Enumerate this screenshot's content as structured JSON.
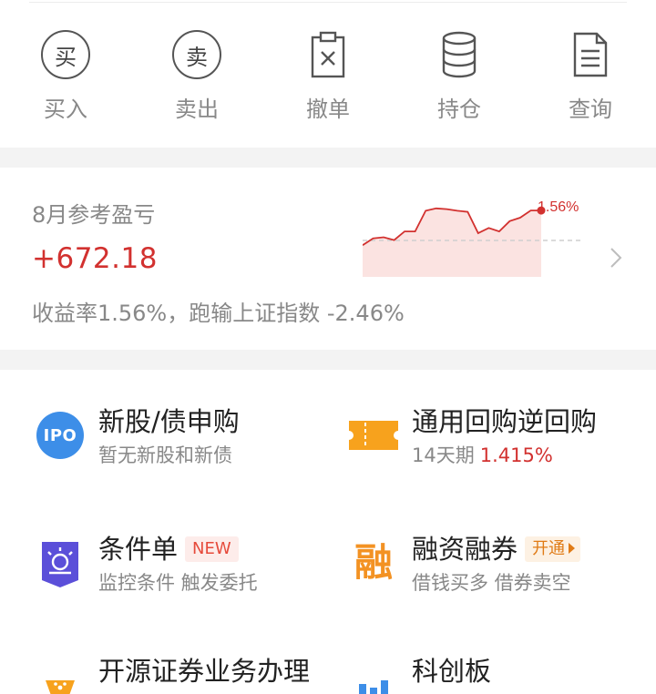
{
  "actions": [
    {
      "id": "buy",
      "icon_char": "买",
      "label": "买入",
      "icon": "buy-circle-icon"
    },
    {
      "id": "sell",
      "icon_char": "卖",
      "label": "卖出",
      "icon": "sell-circle-icon"
    },
    {
      "id": "cancel",
      "label": "撤单",
      "icon": "clipboard-x-icon"
    },
    {
      "id": "position",
      "label": "持仓",
      "icon": "database-stack-icon"
    },
    {
      "id": "query",
      "label": "查询",
      "icon": "document-lines-icon"
    }
  ],
  "profit": {
    "title": "8月参考盈亏",
    "amount": "+672.18",
    "description": "收益率1.56%，跑输上证指数 -2.46%",
    "sparkline_label": "1.56%",
    "sparkline_values": [
      0.55,
      0.75,
      0.78,
      0.7,
      0.95,
      0.95,
      1.55,
      1.62,
      1.6,
      1.55,
      1.52,
      0.9,
      1.05,
      0.95,
      1.25,
      1.35,
      1.56,
      1.56
    ],
    "colors": {
      "up": "#d2312f",
      "fill": "#fbe3e1"
    }
  },
  "features": {
    "ipo": {
      "icon_text": "IPO",
      "title": "新股/债申购",
      "subtitle": "暂无新股和新债"
    },
    "repo": {
      "title": "通用回购逆回购",
      "subtitle": "14天期",
      "rate": "1.415%"
    },
    "condition": {
      "title": "条件单",
      "badge": "NEW",
      "subtitle": "监控条件 触发委托"
    },
    "margin": {
      "icon_text": "融",
      "title": "融资融券",
      "badge": "开通",
      "subtitle": "借钱买多 借券卖空"
    },
    "business": {
      "title": "开源证券业务办理"
    },
    "star": {
      "title": "科创板"
    }
  }
}
